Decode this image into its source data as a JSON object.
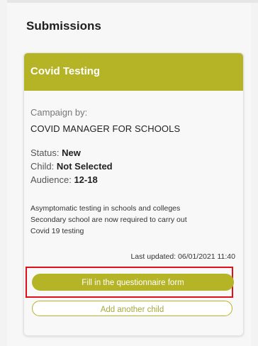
{
  "section": {
    "title": "Submissions"
  },
  "card": {
    "title": "Covid Testing",
    "campaign_label": "Campaign by:",
    "campaign_name": "COVID MANAGER FOR SCHOOLS",
    "status_label": "Status:",
    "status_value": "New",
    "child_label": "Child:",
    "child_value": "Not Selected",
    "audience_label": "Audience:",
    "audience_value": "12-18",
    "description_line1": "Asymptomatic testing in schools and colleges",
    "description_line2": "Secondary school are now required to carry out",
    "description_line3": "Covid 19 testing",
    "last_updated": "Last updated: 06/01/2021 11:40",
    "fill_button_label": "Fill in the questionnaire form",
    "add_child_button_label": "Add another child"
  },
  "colors": {
    "accent": "#b5b326",
    "highlight": "#e0101a"
  }
}
